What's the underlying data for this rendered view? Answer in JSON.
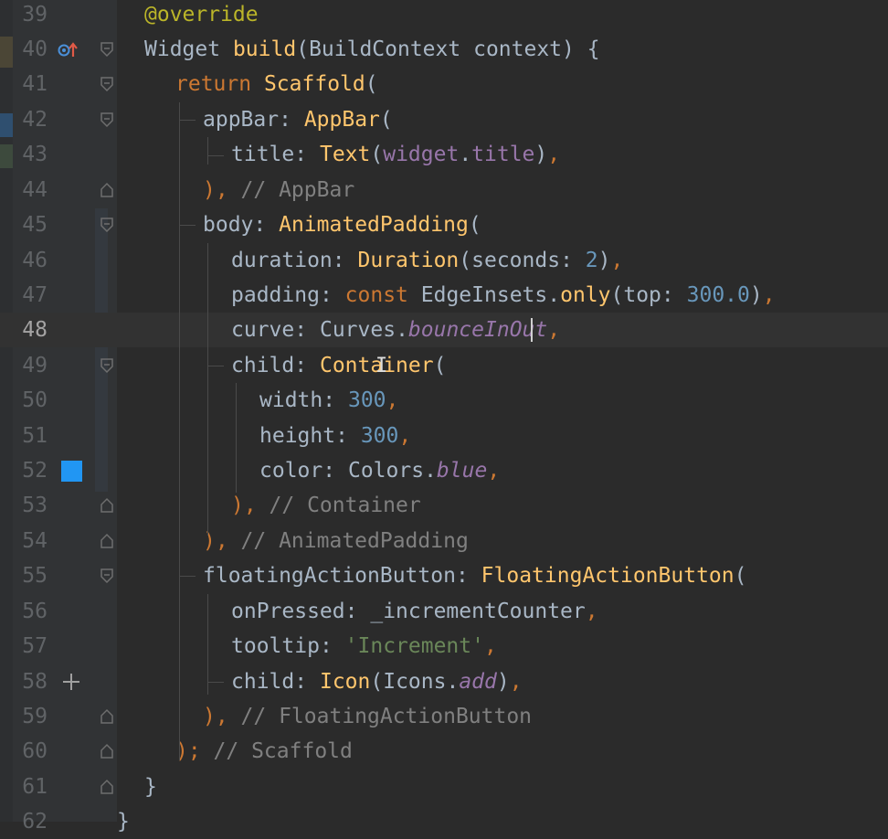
{
  "editor": {
    "language": "dart",
    "current_line": 48,
    "lines": [
      {
        "n": "39",
        "code": "@override"
      },
      {
        "n": "40",
        "code": "Widget build(BuildContext context) {"
      },
      {
        "n": "41",
        "code": "return Scaffold("
      },
      {
        "n": "42",
        "code": "appBar: AppBar("
      },
      {
        "n": "43",
        "code": "title: Text(widget.title),"
      },
      {
        "n": "44",
        "code": "), // AppBar"
      },
      {
        "n": "45",
        "code": "body: AnimatedPadding("
      },
      {
        "n": "46",
        "code": "duration: Duration(seconds: 2),"
      },
      {
        "n": "47",
        "code": "padding: const EdgeInsets.only(top: 300.0),"
      },
      {
        "n": "48",
        "code": "curve: Curves.bounceInOut,"
      },
      {
        "n": "49",
        "code": "child: Container("
      },
      {
        "n": "50",
        "code": "width: 300,"
      },
      {
        "n": "51",
        "code": "height: 300,"
      },
      {
        "n": "52",
        "code": "color: Colors.blue,"
      },
      {
        "n": "53",
        "code": "), // Container"
      },
      {
        "n": "54",
        "code": "), // AnimatedPadding"
      },
      {
        "n": "55",
        "code": "floatingActionButton: FloatingActionButton("
      },
      {
        "n": "56",
        "code": "onPressed: _incrementCounter,"
      },
      {
        "n": "57",
        "code": "tooltip: 'Increment',"
      },
      {
        "n": "58",
        "code": "child: Icon(Icons.add),"
      },
      {
        "n": "59",
        "code": "), // FloatingActionButton"
      },
      {
        "n": "60",
        "code": "); // Scaffold"
      },
      {
        "n": "61",
        "code": "}"
      },
      {
        "n": "62",
        "code": "}"
      }
    ],
    "gutter_icons": {
      "override_icon": "override-marker-icon",
      "color_swatch": "#2196f3",
      "add_icon": "plus-icon"
    },
    "colors": {
      "background": "#2b2b2b",
      "keyword": "#cc7832",
      "function": "#ffc66d",
      "number": "#6897bb",
      "string": "#6a8759",
      "comment": "#808080",
      "field": "#9876aa"
    }
  }
}
